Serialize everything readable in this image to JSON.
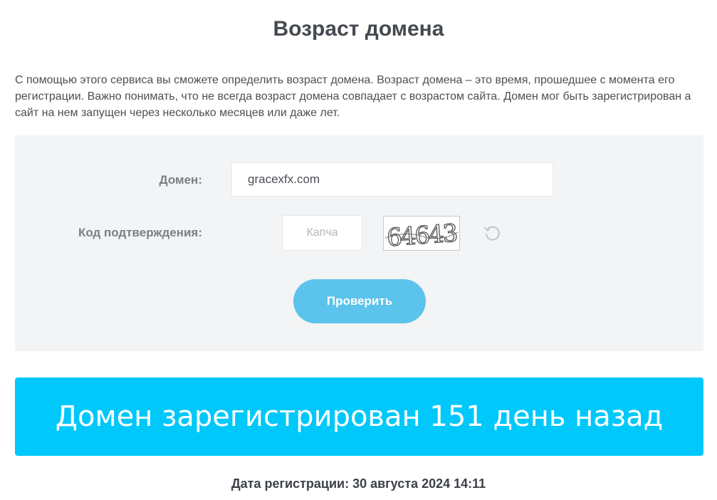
{
  "page": {
    "title": "Возраст домена",
    "intro": "С помощью этого сервиса вы сможете определить возраст домена. Возраст домена – это время, прошедшее с момента его регистрации. Важно понимать, что не всегда возраст домена совпадает с возрастом сайта. Домен мог быть зарегистрирован а сайт на нем запущен через несколько месяцев или даже лет."
  },
  "form": {
    "domain_label": "Домен:",
    "domain_value": "gracexfx.com",
    "captcha_label": "Код подтверждения:",
    "captcha_placeholder": "Капча",
    "captcha_code": "64643",
    "refresh_icon": "refresh-icon",
    "submit_label": "Проверить"
  },
  "result": {
    "banner_text": "Домен зарегистрирован 151 день назад",
    "registration_date": "Дата регистрации: 30 августа 2024 14:11"
  },
  "colors": {
    "accent": "#5bc3ec",
    "banner": "#00c8fa",
    "panel": "#f2f4f5"
  }
}
